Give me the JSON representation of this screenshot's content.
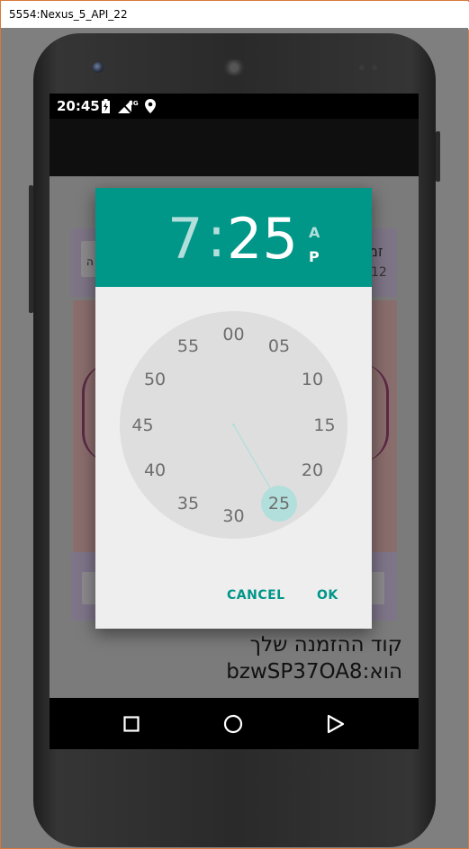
{
  "window": {
    "title": "5554:Nexus_5_API_22"
  },
  "status_bar": {
    "time": "20:45",
    "network_label": "3G",
    "icons": [
      "battery-charging-icon",
      "signal-3g-icon",
      "location-pin-icon"
    ]
  },
  "app_background": {
    "header_fragment": "זמ",
    "sub_fragment": "12",
    "left_button_fragment": "ה",
    "invite_code_text": "קוד ההזמנה שלך הוא:bzwSP37OA8"
  },
  "time_picker": {
    "hour": "7",
    "separator": ":",
    "minute": "25",
    "am_label": "A",
    "pm_label": "P",
    "selected_period": "PM",
    "selected_minute_value": 25,
    "minute_labels": [
      "00",
      "05",
      "10",
      "15",
      "20",
      "25",
      "30",
      "35",
      "40",
      "45",
      "50",
      "55"
    ],
    "cancel_label": "CANCEL",
    "ok_label": "OK",
    "accent_color": "#009688",
    "selector_color": "#b2dfdb"
  },
  "navigation": {
    "buttons": [
      "back-icon",
      "home-icon",
      "recents-icon"
    ]
  }
}
